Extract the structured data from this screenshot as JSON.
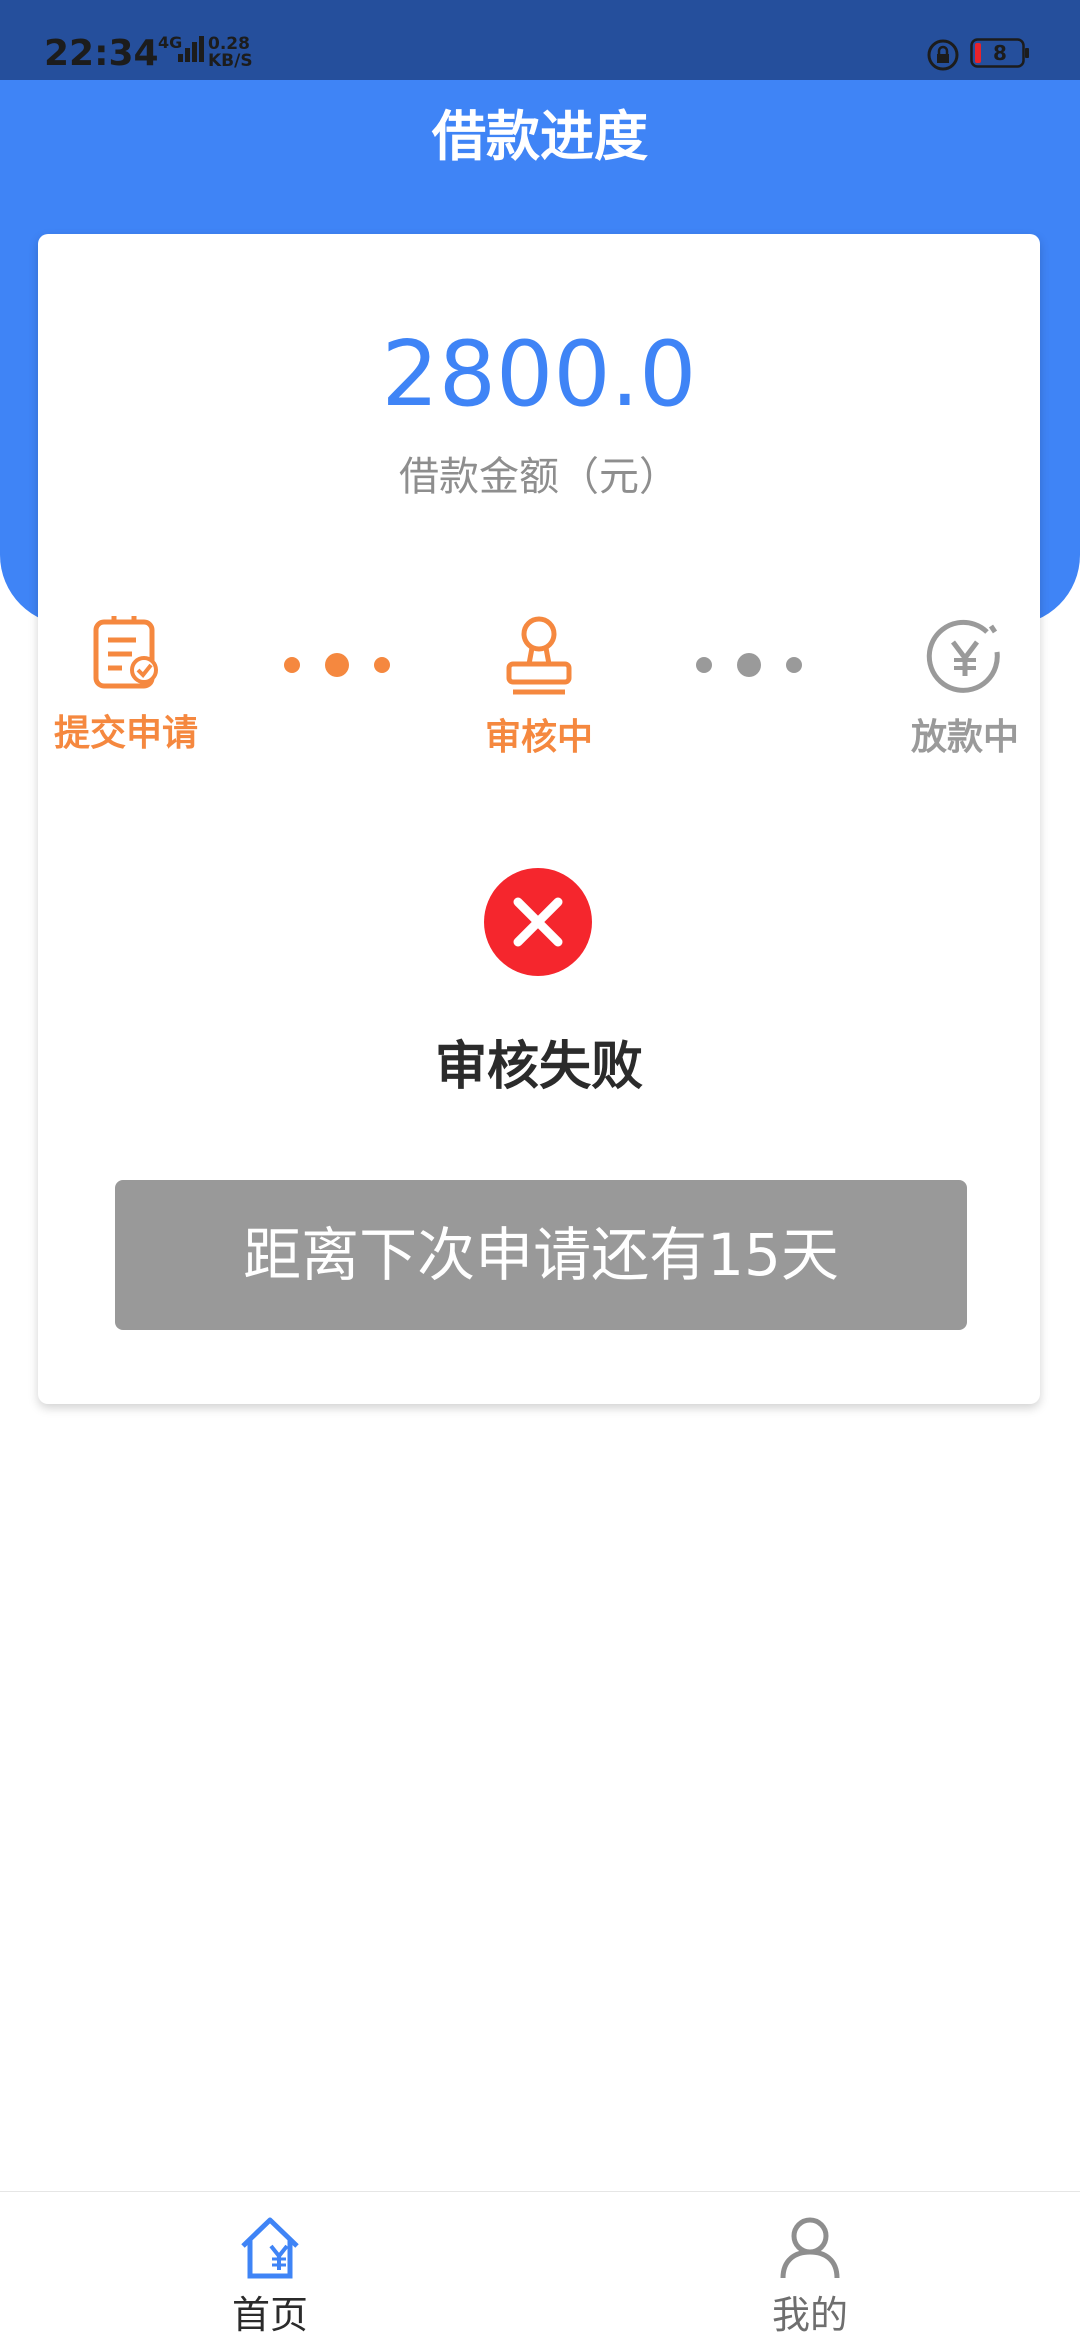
{
  "status_bar": {
    "time": "22:34",
    "network": "4G",
    "speed_value": "0.28",
    "speed_unit": "KB/S",
    "battery": "8"
  },
  "header": {
    "title": "借款进度"
  },
  "loan": {
    "amount": "2800.0",
    "amount_label": "借款金额（元）"
  },
  "steps": [
    {
      "label": "提交申请",
      "icon": "clipboard-check-icon",
      "color": "#f5883f"
    },
    {
      "label": "审核中",
      "icon": "stamp-icon",
      "color": "#f5883f"
    },
    {
      "label": "放款中",
      "icon": "yen-coin-icon",
      "color": "#9a9a9a"
    }
  ],
  "result": {
    "icon": "close-circle-icon",
    "text": "审核失败",
    "color": "#f5262d"
  },
  "reapply": {
    "label": "距离下次申请还有15天"
  },
  "bottom_nav": [
    {
      "label": "首页",
      "icon": "home-yen-icon",
      "active": true,
      "color": "#3f84f6"
    },
    {
      "label": "我的",
      "icon": "user-icon",
      "active": false,
      "color": "#8e8e8e"
    }
  ],
  "colors": {
    "primary": "#3f84f6",
    "accent": "#f5883f",
    "inactive": "#9a9a9a"
  }
}
